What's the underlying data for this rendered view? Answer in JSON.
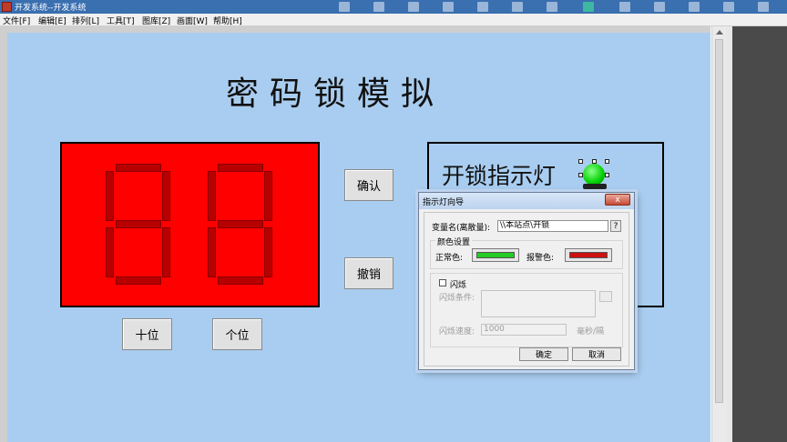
{
  "window": {
    "title": "开发系统--开发系统"
  },
  "menu": [
    {
      "label": "文件[F]"
    },
    {
      "label": "编辑[E]"
    },
    {
      "label": "排列[L]"
    },
    {
      "label": "工具[T]"
    },
    {
      "label": "图库[Z]"
    },
    {
      "label": "画面[W]"
    },
    {
      "label": "帮助[H]"
    }
  ],
  "canvas": {
    "title": "密码锁模拟",
    "confirm_label": "确认",
    "undo_label": "撤销",
    "tens_label": "十位",
    "ones_label": "个位",
    "lamp_label": "开锁指示灯",
    "display_bg": "#ff0000",
    "segment_color": "#b80000",
    "lamp_color": "#00d000"
  },
  "dialog": {
    "title": "指示灯向导",
    "close_label": "x",
    "variable_label": "变量名(离散量):",
    "variable_value": "\\\\本站点\\开锁",
    "browse_label": "?",
    "color_group_label": "颜色设置",
    "normal_color_label": "正常色:",
    "normal_color": "#22cc22",
    "alarm_color_label": "报警色:",
    "alarm_color": "#cc1111",
    "flash_label": "闪烁",
    "flash_condition_label": "闪烁条件:",
    "flash_speed_label": "闪烁速度:",
    "flash_speed_value": "1000",
    "flash_unit_label": "毫秒/隔",
    "ok_label": "确定",
    "cancel_label": "取消"
  }
}
